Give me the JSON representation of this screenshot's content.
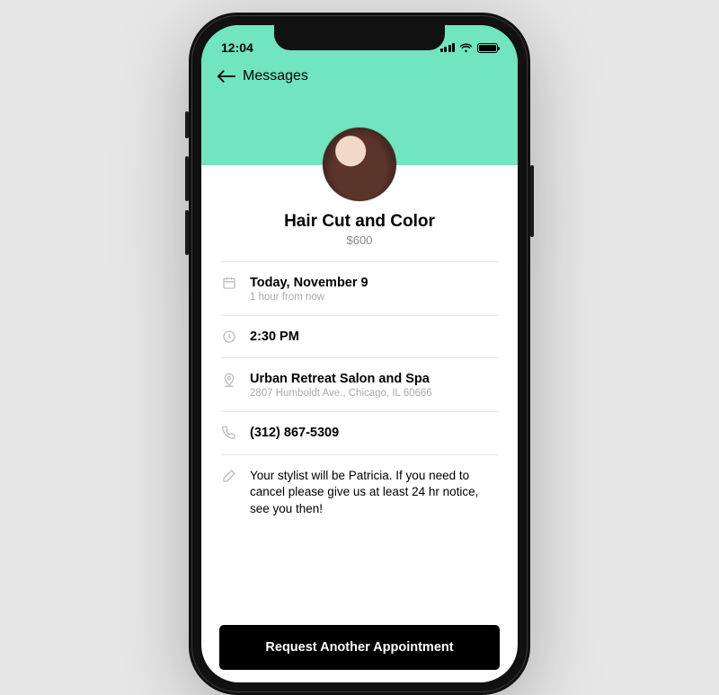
{
  "status": {
    "time": "12:04"
  },
  "nav": {
    "back_label": "Messages"
  },
  "appointment": {
    "title": "Hair Cut and Color",
    "price": "$600",
    "date_line": "Today, November 9",
    "date_sub": "1 hour from now",
    "time": "2:30 PM",
    "location_name": "Urban Retreat Salon and Spa",
    "location_address": "2807 Humboldt Ave., Chicago, IL 60666",
    "phone": "(312) 867-5309",
    "note": "Your stylist will be Patricia. If you need to cancel please give us at least 24 hr notice, see you then!"
  },
  "cta": {
    "label": "Request Another Appointment"
  },
  "colors": {
    "accent": "#70e5bf"
  }
}
